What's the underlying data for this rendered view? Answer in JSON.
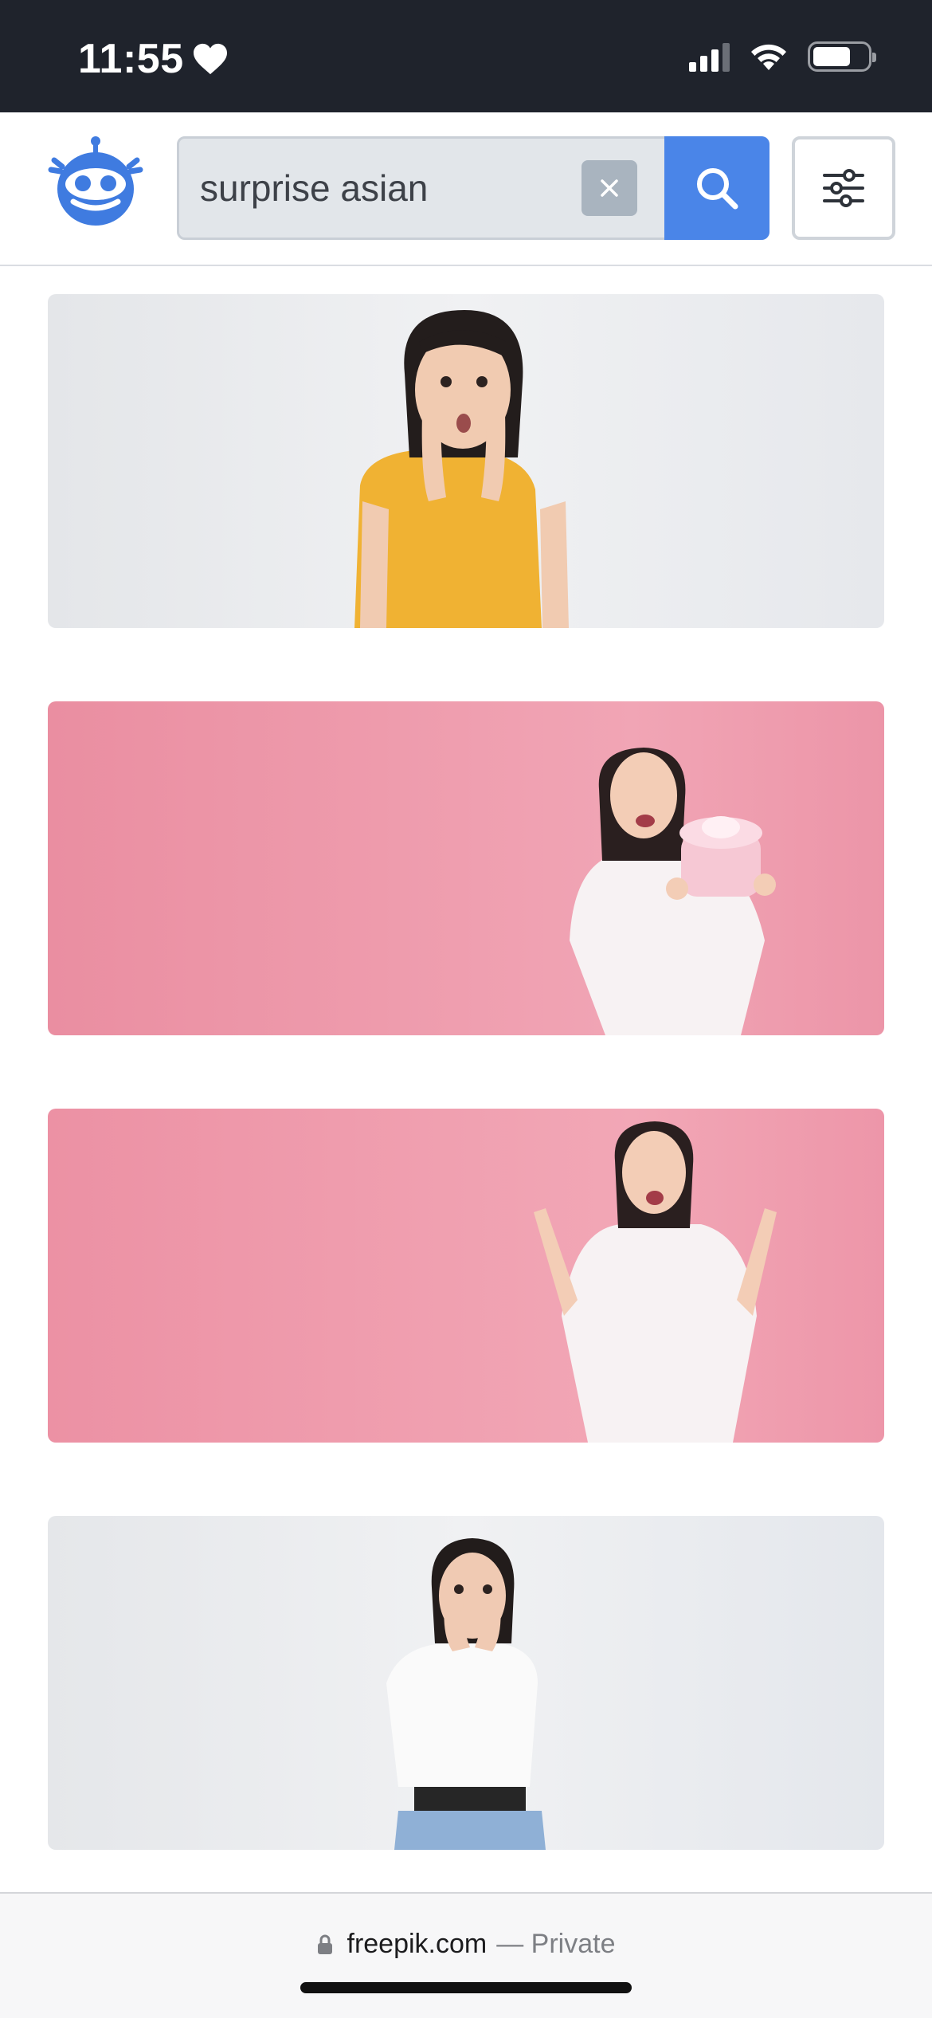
{
  "status_bar": {
    "time": "11:55",
    "icons": [
      "heart-icon",
      "signal-icon",
      "wifi-icon",
      "battery-icon"
    ]
  },
  "header": {
    "logo": "freepik-robot-logo",
    "search": {
      "value": "surprise asian",
      "clear_icon": "close-icon",
      "search_icon": "search-icon"
    },
    "filter_icon": "sliders-icon"
  },
  "results": [
    {
      "background": "#e9ebee",
      "shirt": "#f0b233",
      "pose": "hands-on-cheeks"
    },
    {
      "background": "#ef98aa",
      "shirt": "#f7f2f3",
      "pose": "holding-gift-box"
    },
    {
      "background": "#ef98aa",
      "shirt": "#f7f2f3",
      "pose": "arms-raised"
    },
    {
      "background": "#e9ebee",
      "shirt": "#fafafa",
      "pose": "hands-on-mouth"
    }
  ],
  "url_bar": {
    "domain": "freepik.com",
    "suffix": "— Private"
  },
  "colors": {
    "status_bar": "#1f232c",
    "accent": "#4a85e8",
    "search_bg": "#e2e6ea"
  }
}
